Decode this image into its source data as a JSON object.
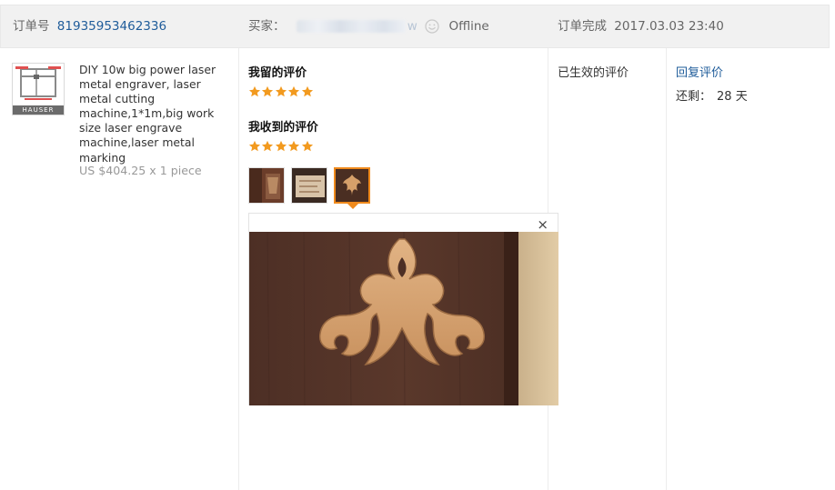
{
  "header": {
    "order_label": "订单号",
    "order_number": "81935953462336",
    "buyer_label": "买家：",
    "buyer_name_tail": "w",
    "buyer_status": "Offline",
    "order_status_label": "订单完成",
    "order_completed_time": "2017.03.03 23:40"
  },
  "product": {
    "thumb_brand": "HAUSER",
    "title": "DIY 10w big power laser metal engraver, laser metal cutting machine,1*1m,big work size laser engrave machine,laser metal marking",
    "price": "US $404.25 x 1 piece"
  },
  "reviews": {
    "left_heading": "我留的评价",
    "left_rating": 5,
    "received_heading": "我收到的评价",
    "received_rating": 5,
    "photo_count": 3,
    "selected_photo_index": 2
  },
  "status_column": {
    "effective_label": "已生效的评价"
  },
  "actions": {
    "reply_label": "回复评价",
    "remaining_label": "还剩：",
    "remaining_value": "28 天"
  },
  "preview": {
    "close_symbol": "×"
  },
  "colors": {
    "link": "#1f5c9a",
    "star": "#f29a1f",
    "selected_border": "#f08a1c",
    "header_bg": "#f1f1f1"
  },
  "icons": [
    "smile-icon",
    "star-icon",
    "close-icon"
  ]
}
